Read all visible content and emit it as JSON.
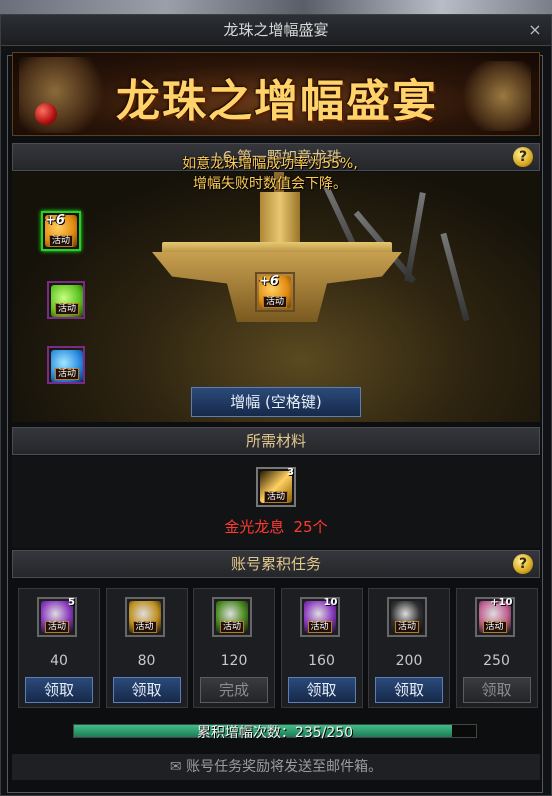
{
  "window": {
    "title": "龙珠之增幅盛宴",
    "close": "×"
  },
  "banner": {
    "title": "龙珠之增幅盛宴"
  },
  "enhance": {
    "header": "+6 第一颗如意龙珠",
    "help": "?",
    "rate_line1": "如意龙珠增幅成功率为55%,",
    "rate_line2": "增幅失败时数值会下降。",
    "button": "增幅 (空格键)",
    "slots": [
      {
        "badge": "+6",
        "tag": "活动",
        "color": "#e08a10",
        "selected": true
      },
      {
        "badge": "",
        "tag": "活动",
        "color": "#5ac020",
        "selected": false
      },
      {
        "badge": "",
        "tag": "活动",
        "color": "#2a8ae0",
        "selected": false
      }
    ],
    "anvil_item": {
      "badge": "+6",
      "tag": "活动"
    }
  },
  "materials": {
    "header": "所需材料",
    "item": {
      "count": "3",
      "tag": "活动"
    },
    "name": "金光龙息",
    "quantity": "25个"
  },
  "tasks": {
    "header": "账号累积任务",
    "help": "?",
    "items": [
      {
        "target": "40",
        "button": "领取",
        "enabled": true,
        "badge": "5",
        "color": "#8a3ac0",
        "tag": "活动"
      },
      {
        "target": "80",
        "button": "领取",
        "enabled": true,
        "badge": "",
        "color": "#c09020",
        "tag": "活动"
      },
      {
        "target": "120",
        "button": "完成",
        "enabled": false,
        "badge": "",
        "color": "#4a8a20",
        "tag": "活动"
      },
      {
        "target": "160",
        "button": "领取",
        "enabled": true,
        "badge": "10",
        "color": "#8a3ac0",
        "tag": "活动"
      },
      {
        "target": "200",
        "button": "领取",
        "enabled": true,
        "badge": "",
        "color": "#303030",
        "tag": "活动"
      },
      {
        "target": "250",
        "button": "领取",
        "enabled": false,
        "badge": "+10",
        "color": "#c06090",
        "tag": "活动"
      }
    ]
  },
  "progress": {
    "label": "累积增幅次数：235/250",
    "current": 235,
    "total": 250
  },
  "mail_notice": "账号任务奖励将发送至邮件箱。"
}
